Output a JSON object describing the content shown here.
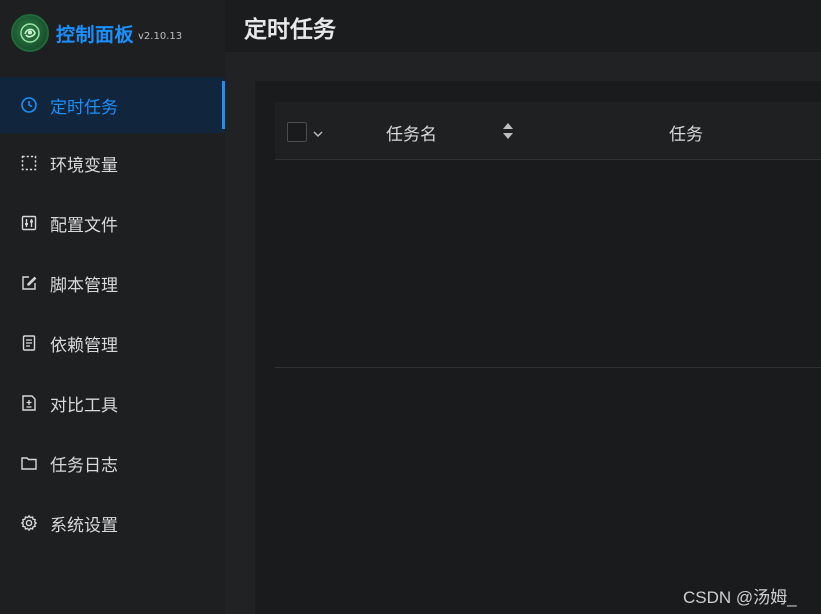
{
  "brand": {
    "title": "控制面板",
    "version": "v2.10.13"
  },
  "sidebar": {
    "items": [
      {
        "label": "定时任务",
        "icon": "clock-icon",
        "active": true
      },
      {
        "label": "环境变量",
        "icon": "dashed-square-icon",
        "active": false
      },
      {
        "label": "配置文件",
        "icon": "sliders-icon",
        "active": false
      },
      {
        "label": "脚本管理",
        "icon": "edit-icon",
        "active": false
      },
      {
        "label": "依赖管理",
        "icon": "file-text-icon",
        "active": false
      },
      {
        "label": "对比工具",
        "icon": "file-diff-icon",
        "active": false
      },
      {
        "label": "任务日志",
        "icon": "folder-icon",
        "active": false
      },
      {
        "label": "系统设置",
        "icon": "gear-icon",
        "active": false
      }
    ]
  },
  "header": {
    "title": "定时任务"
  },
  "table": {
    "columns": {
      "name": "任务名",
      "task": "任务"
    }
  },
  "watermark": "CSDN @汤姆_",
  "colors": {
    "accent": "#1890ff",
    "sidebar_bg": "#1e1f21",
    "active_bg": "#11263c"
  }
}
